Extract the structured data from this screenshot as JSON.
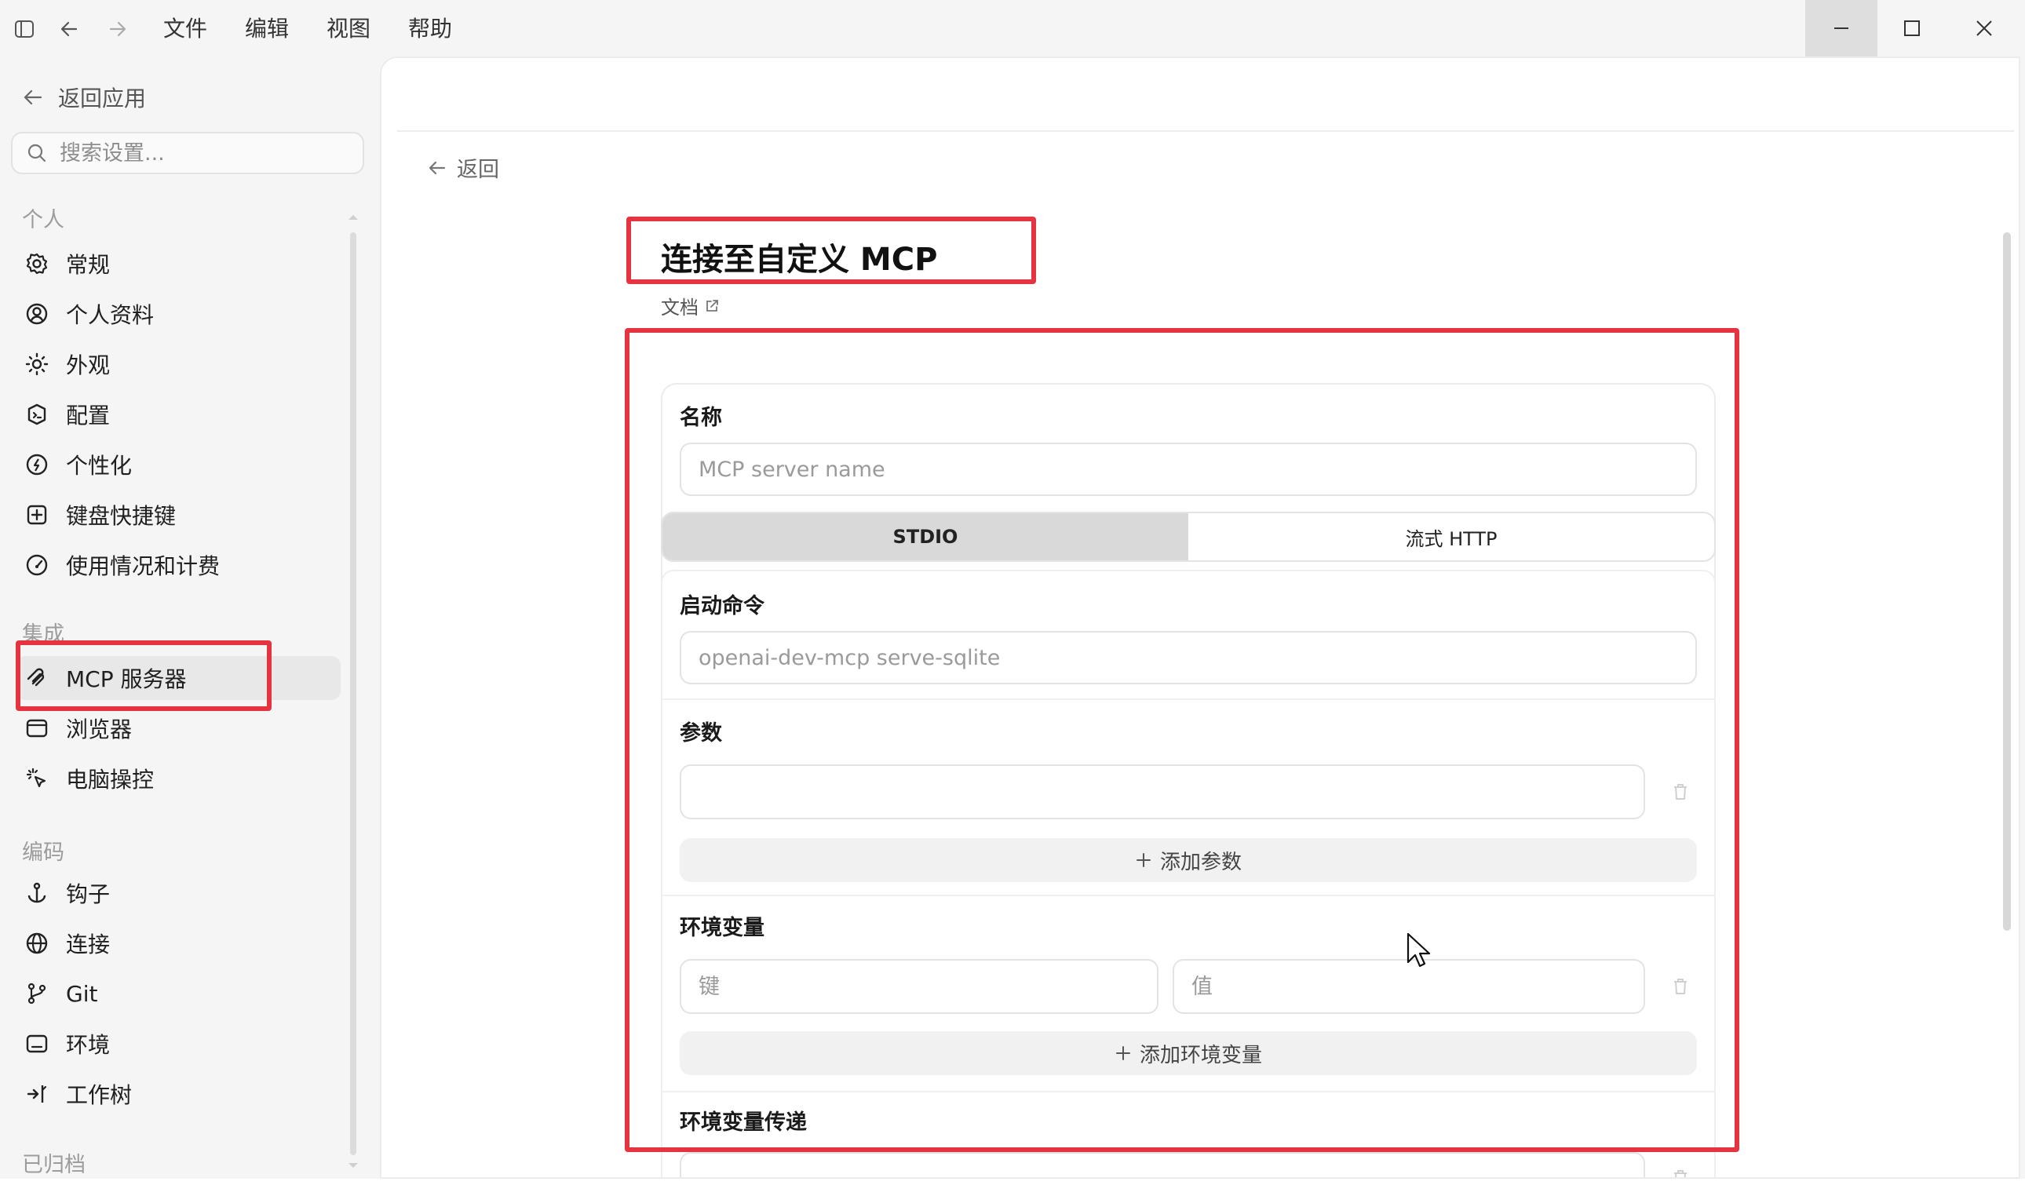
{
  "menu": [
    "文件",
    "编辑",
    "视图",
    "帮助"
  ],
  "sidebar": {
    "back_label": "返回应用",
    "search_placeholder": "搜索设置...",
    "sections": [
      {
        "label": "个人",
        "items": [
          {
            "label": "常规",
            "icon": "gear-icon"
          },
          {
            "label": "个人资料",
            "icon": "user-circle-icon"
          },
          {
            "label": "外观",
            "icon": "sun-icon"
          },
          {
            "label": "配置",
            "icon": "config-icon"
          },
          {
            "label": "个性化",
            "icon": "personalize-icon"
          },
          {
            "label": "键盘快捷键",
            "icon": "keyboard-icon"
          },
          {
            "label": "使用情况和计费",
            "icon": "gauge-icon"
          }
        ]
      },
      {
        "label": "集成",
        "items": [
          {
            "label": "MCP 服务器",
            "icon": "mcp-icon",
            "active": true
          },
          {
            "label": "浏览器",
            "icon": "browser-icon"
          },
          {
            "label": "电脑操控",
            "icon": "cursor-click-icon"
          }
        ]
      },
      {
        "label": "编码",
        "items": [
          {
            "label": "钩子",
            "icon": "anchor-icon"
          },
          {
            "label": "连接",
            "icon": "globe-icon"
          },
          {
            "label": "Git",
            "icon": "git-branch-icon"
          },
          {
            "label": "环境",
            "icon": "terminal-icon"
          },
          {
            "label": "工作树",
            "icon": "worktree-icon"
          }
        ]
      },
      {
        "label": "已归档",
        "items": []
      }
    ]
  },
  "main": {
    "back_label": "返回",
    "title": "连接至自定义 MCP",
    "docs_label": "文档",
    "name_label": "名称",
    "name_placeholder": "MCP server name",
    "transport_options": [
      "STDIO",
      "流式 HTTP"
    ],
    "transport_selected": "STDIO",
    "command_label": "启动命令",
    "command_placeholder": "openai-dev-mcp serve-sqlite",
    "args_label": "参数",
    "add_arg_label": "添加参数",
    "env_label": "环境变量",
    "env_key_placeholder": "键",
    "env_value_placeholder": "值",
    "add_env_label": "添加环境变量",
    "env_passthrough_label": "环境变量传递"
  },
  "colors": {
    "highlight": "#e53340",
    "selected_segment": "#d9d9d9",
    "active_nav": "#e8e8e8"
  }
}
